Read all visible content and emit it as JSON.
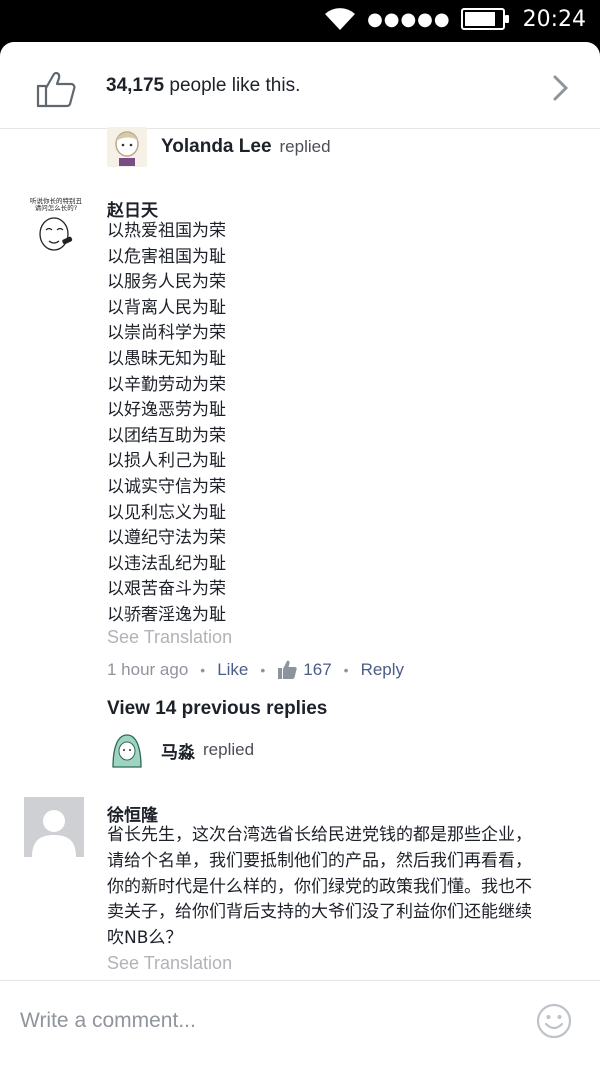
{
  "status_bar": {
    "time": "20:24",
    "signal_dots": "●●●●●",
    "battery_level": 0.85,
    "icons": [
      "wifi-icon",
      "signal-dots-icon",
      "battery-icon"
    ]
  },
  "likes": {
    "count": "34,175",
    "suffix": " people like this.",
    "icon": "thumb-up-icon"
  },
  "reply_1": {
    "name": "Yolanda Lee",
    "verb": "replied"
  },
  "comment_1": {
    "author": "赵日天",
    "avatar_text": "听说你长的特别丑\n请问怎么长的?",
    "lines": [
      "以热爱祖国为荣",
      "以危害祖国为耻",
      "以服务人民为荣",
      "以背离人民为耻",
      "以崇尚科学为荣",
      "以愚昧无知为耻",
      "以辛勤劳动为荣",
      "以好逸恶劳为耻",
      "以团结互助为荣",
      "以损人利己为耻",
      "以诚实守信为荣",
      "以见利忘义为耻",
      "以遵纪守法为荣",
      "以违法乱纪为耻",
      "以艰苦奋斗为荣",
      "以骄奢淫逸为耻"
    ],
    "see_translation": "See Translation",
    "time": "1 hour ago",
    "like_label": "Like",
    "like_count": "167",
    "reply_label": "Reply"
  },
  "view_previous": "View 14 previous replies",
  "reply_2": {
    "name": "马淼",
    "verb": "replied"
  },
  "comment_2": {
    "author": "徐恒隆",
    "text": "省长先生，这次台湾选省长给民进党钱的都是那些企业，请给个名单，我们要抵制他们的产品，然后我们再看看，你的新时代是什么样的，你们绿党的政策我们懂。我也不卖关子，给你们背后支持的大爷们没了利益你们还能继续吹NB么？",
    "see_translation": "See Translation"
  },
  "composer": {
    "placeholder": "Write a comment..."
  },
  "colors": {
    "link": "#4b5e86",
    "muted": "#90949c",
    "text": "#1d2129"
  }
}
